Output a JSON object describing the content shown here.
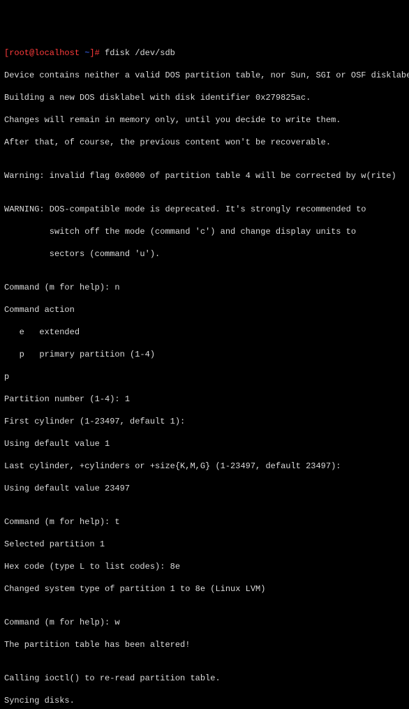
{
  "prompt": {
    "user_host": "[root@localhost ",
    "path": "~",
    "tail": "]# ",
    "command": "fdisk /dev/sdb"
  },
  "lines": {
    "l1": "Device contains neither a valid DOS partition table, nor Sun, SGI or OSF disklabel",
    "l2": "Building a new DOS disklabel with disk identifier 0x279825ac.",
    "l3": "Changes will remain in memory only, until you decide to write them.",
    "l4": "After that, of course, the previous content won't be recoverable.",
    "l5": "",
    "l6": "Warning: invalid flag 0x0000 of partition table 4 will be corrected by w(rite)",
    "l7": "",
    "l8": "WARNING: DOS-compatible mode is deprecated. It's strongly recommended to",
    "l9": "         switch off the mode (command 'c') and change display units to",
    "l10": "         sectors (command 'u').",
    "l11": "",
    "l12": "Command (m for help): n",
    "l13": "Command action",
    "l14": "   e   extended",
    "l15": "   p   primary partition (1-4)",
    "l16": "p",
    "l17": "Partition number (1-4): 1",
    "l18": "First cylinder (1-23497, default 1):",
    "l19": "Using default value 1",
    "l20": "Last cylinder, +cylinders or +size{K,M,G} (1-23497, default 23497):",
    "l21": "Using default value 23497",
    "l22": "",
    "l23": "Command (m for help): t",
    "l24": "Selected partition 1",
    "l25": "Hex code (type L to list codes): 8e",
    "l26": "Changed system type of partition 1 to 8e (Linux LVM)",
    "l27": "",
    "l28": "Command (m for help): w",
    "l29": "The partition table has been altered!",
    "l30": "",
    "l31": "Calling ioctl() to re-read partition table.",
    "l32": "Syncing disks."
  }
}
